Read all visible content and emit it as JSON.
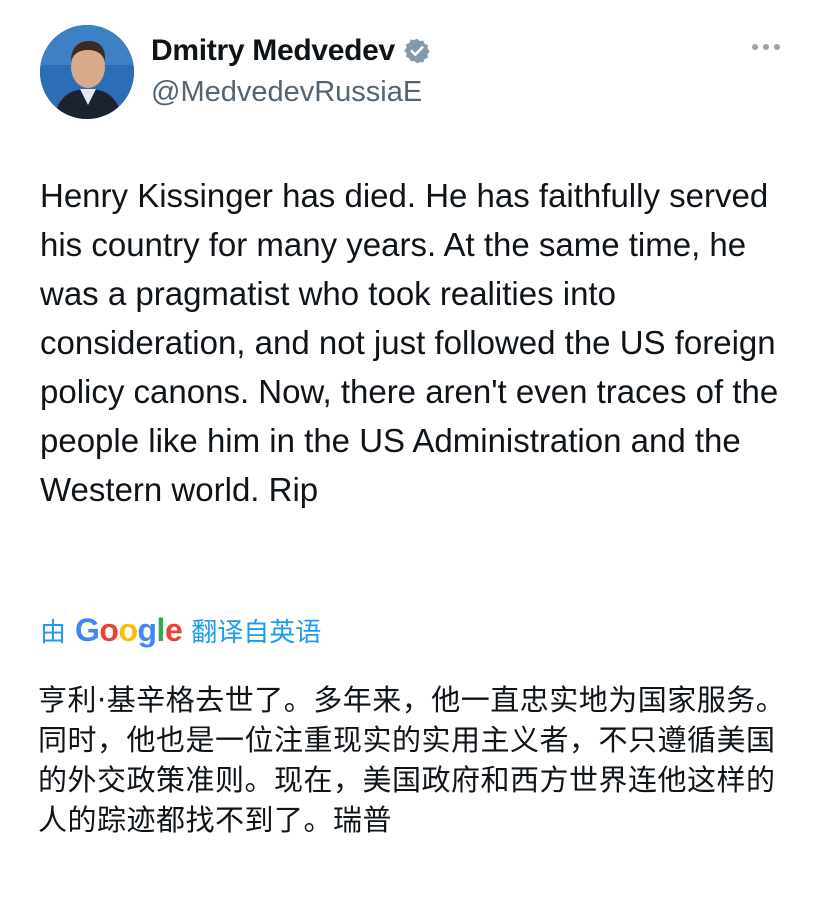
{
  "profile": {
    "display_name": "Dmitry Medvedev",
    "handle": "@MedvedevRussiaE",
    "verified": true,
    "badge_color": "#829aab",
    "avatar_icon": "profile-photo"
  },
  "more_icon": "more-options-icon",
  "tweet": {
    "text": "Henry Kissinger has died. He has faithfully served his country for many years. At the same time, he was a pragmatist who took realities into consideration, and not just followed the US foreign policy canons. Now, there aren't even traces of the people like him in the US Administration and the Western world. Rip"
  },
  "translation": {
    "prefix": "由",
    "brand": "Google",
    "suffix": "翻译自英语",
    "text": "亨利·基辛格去世了。多年来，他一直忠实地为国家服务。同时，他也是一位注重现实的实用主义者，不只遵循美国的外交政策准则。现在，美国政府和西方世界连他这样的人的踪迹都找不到了。瑞普"
  },
  "colors": {
    "link": "#1d9bf0",
    "secondary_text": "#536471",
    "primary_text": "#0f1419"
  }
}
